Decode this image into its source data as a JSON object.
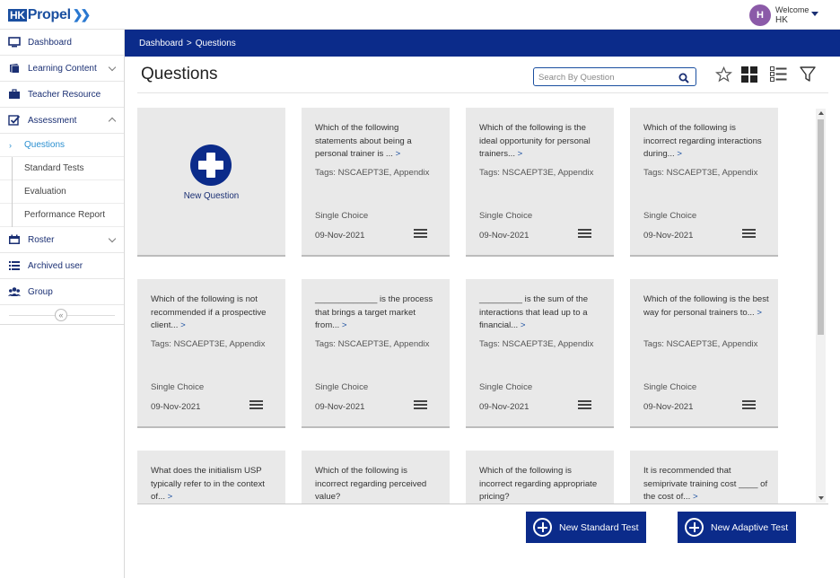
{
  "header": {
    "logo_text": "HKPropel",
    "welcome_label": "Welcome",
    "user_name": "HK",
    "avatar_initial": "H"
  },
  "sidebar": {
    "items": [
      {
        "label": "Dashboard",
        "icon": "monitor-icon"
      },
      {
        "label": "Learning Content",
        "icon": "book-icon",
        "expandable": true
      },
      {
        "label": "Teacher Resource",
        "icon": "briefcase-icon"
      },
      {
        "label": "Assessment",
        "icon": "checkbox-icon",
        "expanded": true
      },
      {
        "label": "Roster",
        "icon": "calendar-icon",
        "expandable": true
      },
      {
        "label": "Archived user",
        "icon": "list-icon"
      },
      {
        "label": "Group",
        "icon": "people-icon"
      }
    ],
    "assessment_children": [
      {
        "label": "Questions",
        "active": true
      },
      {
        "label": "Standard Tests"
      },
      {
        "label": "Evaluation"
      },
      {
        "label": "Performance Report"
      }
    ],
    "collapse_glyph": "«"
  },
  "breadcrumb": {
    "root": "Dashboard",
    "separator": ">",
    "current": "Questions"
  },
  "page": {
    "title": "Questions",
    "search_placeholder": "Search By Question"
  },
  "new_question_label": "New Question",
  "cards": [
    {
      "question": "Which of the following statements about being a personal trainer is ...",
      "more": ">",
      "tags": "Tags: NSCAEPT3E, Appendix",
      "type": "Single Choice",
      "date": "09-Nov-2021"
    },
    {
      "question": "Which of the following is the ideal opportunity for personal trainers...",
      "more": ">",
      "tags": "Tags: NSCAEPT3E, Appendix",
      "type": "Single Choice",
      "date": "09-Nov-2021"
    },
    {
      "question": "Which of the following is incorrect regarding interactions during...",
      "more": ">",
      "tags": "Tags: NSCAEPT3E, Appendix",
      "type": "Single Choice",
      "date": "09-Nov-2021"
    },
    {
      "question": "Which of the following is not recommended if a prospective client...",
      "more": ">",
      "tags": "Tags: NSCAEPT3E, Appendix",
      "type": "Single Choice",
      "date": "09-Nov-2021"
    },
    {
      "question": "_____________ is the process that brings a target market from...",
      "more": ">",
      "tags": "Tags: NSCAEPT3E, Appendix",
      "type": "Single Choice",
      "date": "09-Nov-2021"
    },
    {
      "question": "_________ is the sum of the interactions that lead up to a financial...",
      "more": ">",
      "tags": "Tags: NSCAEPT3E, Appendix",
      "type": "Single Choice",
      "date": "09-Nov-2021"
    },
    {
      "question": "Which of the following is the best way for personal trainers to...",
      "more": ">",
      "tags": "Tags: NSCAEPT3E, Appendix",
      "type": "Single Choice",
      "date": "09-Nov-2021"
    },
    {
      "question": "What does the initialism USP typically refer to in the context of...",
      "more": ">",
      "tags": "",
      "type": "",
      "date": ""
    },
    {
      "question": "Which of the following is incorrect regarding perceived value?",
      "more": "",
      "tags": "",
      "type": "",
      "date": ""
    },
    {
      "question": "Which of the following is incorrect regarding appropriate pricing?",
      "more": "",
      "tags": "",
      "type": "",
      "date": ""
    },
    {
      "question": "It is recommended that semiprivate training cost ____ of the cost of...",
      "more": ">",
      "tags": "",
      "type": "",
      "date": ""
    }
  ],
  "actions": {
    "new_standard_test": "New Standard Test",
    "new_adaptive_test": "New Adaptive Test"
  },
  "colors": {
    "primary": "#0b2b8a",
    "active_link": "#2a8fd0",
    "card_bg": "#e9e9e9",
    "avatar": "#8b5aa8"
  }
}
